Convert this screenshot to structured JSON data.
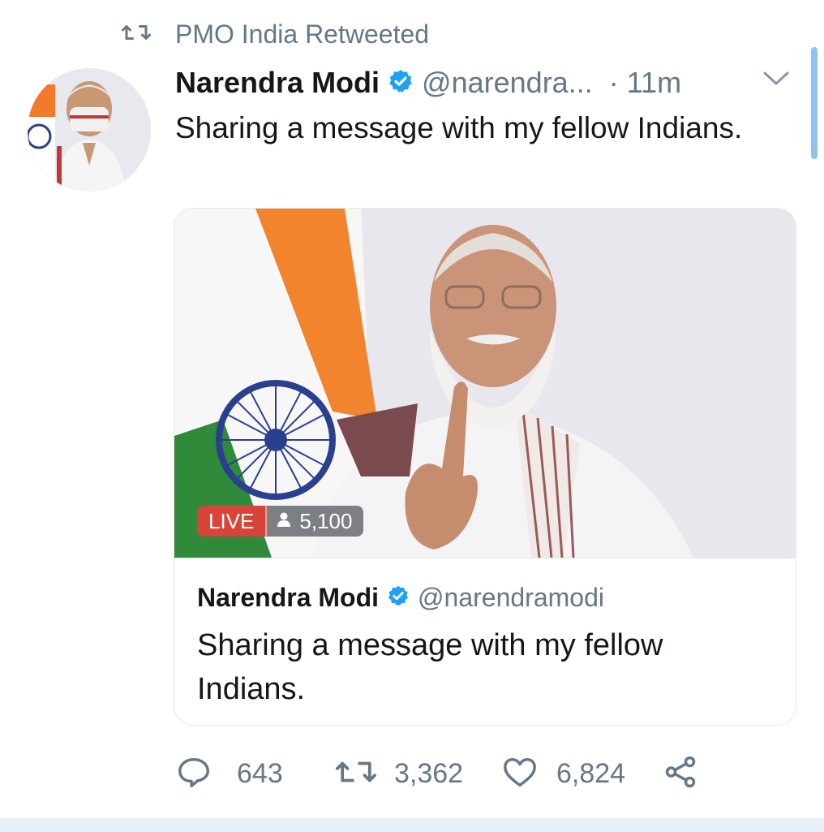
{
  "retweet_header": {
    "icon": "retweet-icon",
    "text": "PMO India Retweeted"
  },
  "tweet": {
    "author_name": "Narendra Modi",
    "verified": true,
    "handle": "@narendra...",
    "time": "· 11m",
    "text": "Sharing a message with my fellow Indians."
  },
  "card": {
    "live_label": "LIVE",
    "viewer_count": "5,100",
    "author_name": "Narendra Modi",
    "handle": "@narendramodi",
    "text": "Sharing a message with my fellow Indians."
  },
  "actions": {
    "replies": "643",
    "retweets": "3,362",
    "likes": "6,824"
  },
  "colors": {
    "verified_blue": "#1da1f2",
    "muted": "#657786",
    "live_red": "#d9443a"
  }
}
